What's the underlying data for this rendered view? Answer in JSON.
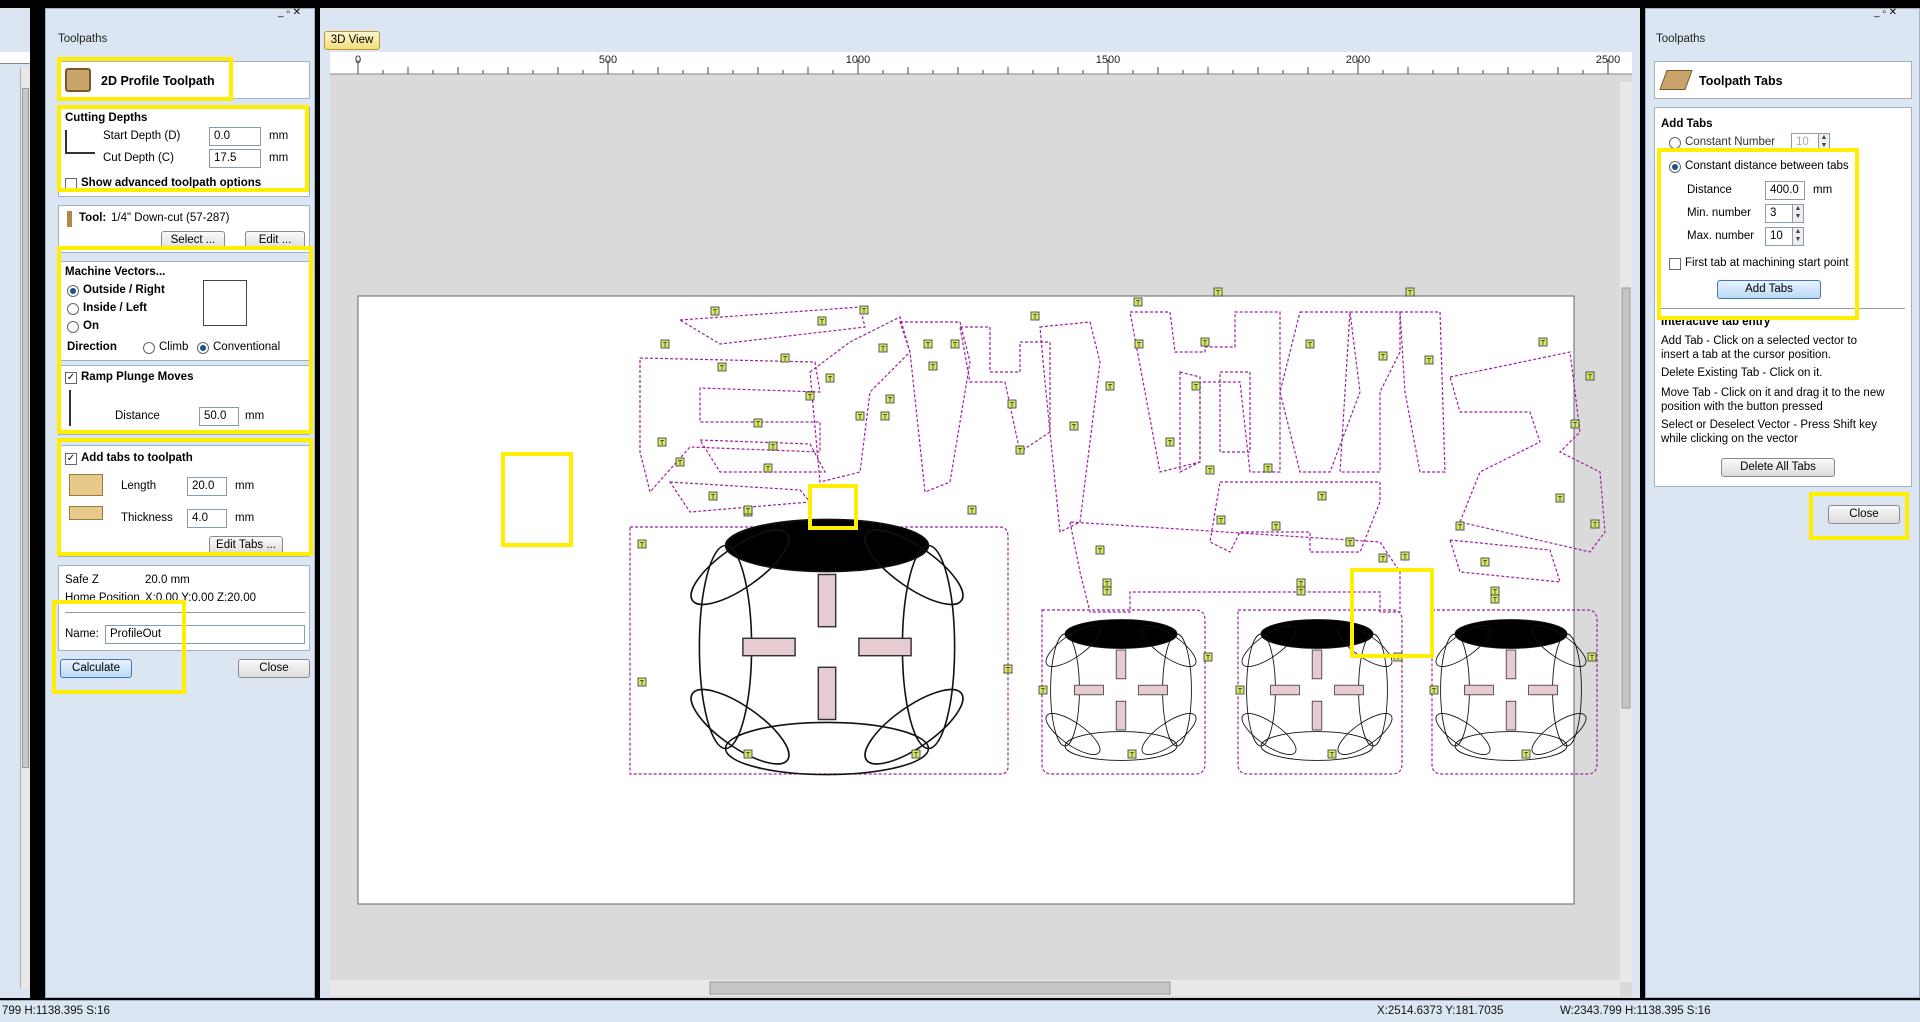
{
  "left_panel": {
    "title": "Toolpaths",
    "header": "2D Profile Toolpath",
    "cutting_depths": {
      "title": "Cutting Depths",
      "start_label": "Start Depth (D)",
      "start_value": "0.0",
      "cut_label": "Cut Depth (C)",
      "cut_value": "17.5",
      "unit": "mm",
      "advanced": "Show advanced toolpath options"
    },
    "tool": {
      "label": "Tool:",
      "value": "1/4\" Down-cut (57-287)",
      "select": "Select ...",
      "edit": "Edit ..."
    },
    "machine_vectors": {
      "title": "Machine Vectors...",
      "outside": "Outside / Right",
      "inside": "Inside / Left",
      "on": "On",
      "direction": "Direction",
      "climb": "Climb",
      "conventional": "Conventional"
    },
    "ramp": {
      "title": "Ramp Plunge Moves",
      "distance_label": "Distance",
      "distance_value": "50.0",
      "unit": "mm"
    },
    "tabs": {
      "title": "Add tabs to toolpath",
      "length_label": "Length",
      "length_value": "20.0",
      "thickness_label": "Thickness",
      "thickness_value": "4.0",
      "unit": "mm",
      "edit": "Edit Tabs ..."
    },
    "safe_z_label": "Safe Z",
    "safe_z_value": "20.0 mm",
    "home_label": "Home Position",
    "home_value": "X:0.00 Y:0.00 Z:20.00",
    "name_label": "Name:",
    "name_value": "ProfileOut",
    "calculate": "Calculate",
    "close": "Close"
  },
  "view": {
    "tab": "3D View",
    "ruler": [
      "0",
      "500",
      "1000",
      "1500",
      "2000",
      "2500"
    ],
    "tab_marker": "T"
  },
  "right_panel": {
    "title": "Toolpaths",
    "header": "Toolpath Tabs",
    "add_tabs_title": "Add Tabs",
    "constant_number": "Constant Number",
    "constant_number_value": "10",
    "constant_distance": "Constant distance between tabs",
    "distance_label": "Distance",
    "distance_value": "400.0",
    "unit": "mm",
    "min_label": "Min. number",
    "min_value": "3",
    "max_label": "Max. number",
    "max_value": "10",
    "first_tab": "First tab at machining start point",
    "add_tabs_button": "Add Tabs",
    "interactive_title": "Interactive tab entry",
    "help_add": "Add Tab - Click on a selected vector to insert a tab at the cursor position.",
    "help_delete": "Delete Existing Tab - Click on it.",
    "help_move": "Move Tab - Click on it and drag it to the new position with the button pressed",
    "help_select": "Select or Deselect Vector - Press Shift key while clicking on the vector",
    "delete_all": "Delete All Tabs",
    "close": "Close"
  },
  "status": {
    "left": "799  H:1138.395  S:16",
    "center": "X:2514.6373 Y:181.7035",
    "right": "W:2343.799  H:1138.395  S:16"
  },
  "colors": {
    "highlight": "#ffee00",
    "toolpath": "#a020a0",
    "tab_fill": "#d6e86a"
  }
}
